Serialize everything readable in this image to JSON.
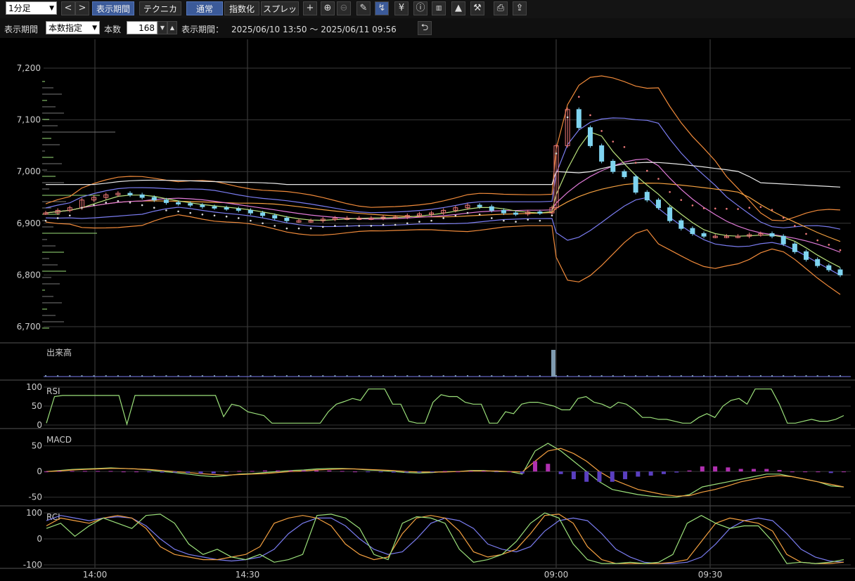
{
  "toolbar": {
    "timeframe": "1分足",
    "btn_period": "表示期間",
    "btn_technical": "テクニカル",
    "btn_normal": "通常",
    "btn_index": "指数化",
    "btn_spread": "スプレッド",
    "icons": [
      "crosshair-icon",
      "zoom-in-icon",
      "zoom-out-icon",
      "pencil-icon",
      "trend-tool-icon",
      "yen-icon",
      "info-icon",
      "my-chart-icon",
      "area-chart-icon",
      "wrench-icon",
      "print-icon",
      "export-icon"
    ]
  },
  "period_bar": {
    "label": "表示期間",
    "mode": "本数指定",
    "count_label": "本数",
    "count": "168",
    "range_label": "表示期間：",
    "range": "2025/06/10 13:50 ～ 2025/06/11 09:56"
  },
  "colors": {
    "ma_short": "#b8e07a",
    "ma_mid": "#e07ad8",
    "ma_long": "#f4a040",
    "bb_inner": "#7a7cf0",
    "bb_outer": "#f08a3a",
    "upper_band": "#e8e8e8",
    "sar_down": "#f07a7a",
    "sar_up": "#dddddd",
    "candle_up": "#f07a7a",
    "candle_down": "#7fd4f0",
    "rsi": "#9be07a",
    "macd": "#9be07a",
    "signal": "#f4a040",
    "hist_pos": "#b030b0",
    "hist_neg": "#5a3fc0",
    "rci_short": "#9be07a",
    "rci_mid": "#f4a040",
    "rci_long": "#7a7cf0"
  },
  "chart_data": {
    "type": "line",
    "price_axis": {
      "ticks": [
        "7,200",
        "7,100",
        "7,000",
        "6,900",
        "6,800",
        "6,700"
      ],
      "ylim": [
        6680,
        7225
      ]
    },
    "x_ticks": [
      "14:00",
      "14:30",
      "09:00",
      "09:30"
    ],
    "close": [
      6920,
      6925,
      6930,
      6945,
      6950,
      6955,
      6958,
      6955,
      6950,
      6945,
      6940,
      6938,
      6935,
      6932,
      6930,
      6928,
      6925,
      6920,
      6915,
      6910,
      6905,
      6905,
      6905,
      6908,
      6910,
      6910,
      6910,
      6910,
      6912,
      6912,
      6915,
      6918,
      6920,
      6925,
      6930,
      6935,
      6932,
      6925,
      6920,
      6918,
      6922,
      6920,
      6930,
      7050,
      7120,
      7085,
      7050,
      7020,
      7000,
      6990,
      6960,
      6945,
      6930,
      6905,
      6890,
      6880,
      6875,
      6875,
      6875,
      6875,
      6878,
      6880,
      6875,
      6860,
      6845,
      6830,
      6818,
      6810,
      6800
    ],
    "volume_panel": {
      "title": "出来高",
      "spike": "09:00"
    },
    "rsi_panel": {
      "title": "RSI",
      "ticks": [
        "100",
        "50",
        "0"
      ],
      "values": [
        5,
        75,
        78,
        78,
        78,
        78,
        78,
        78,
        78,
        78,
        2,
        78,
        78,
        78,
        78,
        78,
        78,
        78,
        78,
        78,
        78,
        78,
        22,
        55,
        50,
        35,
        30,
        25,
        5,
        5,
        5,
        5,
        5,
        5,
        5,
        35,
        55,
        62,
        70,
        65,
        95,
        95,
        95,
        55,
        55,
        10,
        5,
        5,
        60,
        80,
        75,
        75,
        60,
        55,
        55,
        5,
        5,
        35,
        30,
        55,
        60,
        60,
        55,
        50,
        40,
        40,
        70,
        75,
        60,
        55,
        45,
        60,
        55,
        40,
        20,
        20,
        15,
        15,
        10,
        5,
        5,
        20,
        30,
        20,
        50,
        65,
        70,
        55,
        95,
        95,
        95,
        55,
        5,
        5,
        10,
        15,
        10,
        10,
        15,
        25
      ]
    },
    "macd_panel": {
      "title": "MACD",
      "ticks": [
        "50",
        "0",
        "-50"
      ],
      "macd": [
        0,
        2,
        4,
        5,
        6,
        7,
        6,
        5,
        3,
        0,
        -2,
        -5,
        -8,
        -10,
        -8,
        -5,
        -4,
        -2,
        0,
        2,
        3,
        5,
        6,
        6,
        5,
        3,
        2,
        0,
        -2,
        -3,
        -2,
        0,
        0,
        2,
        2,
        0,
        0,
        -5,
        40,
        55,
        40,
        20,
        0,
        -20,
        -35,
        -40,
        -45,
        -48,
        -50,
        -50,
        -45,
        -30,
        -25,
        -20,
        -15,
        -10,
        -5,
        -5,
        -10,
        -15,
        -20,
        -28,
        -30
      ],
      "signal": [
        0,
        1,
        3,
        4,
        5,
        6,
        6,
        5,
        4,
        2,
        0,
        -2,
        -4,
        -6,
        -7,
        -6,
        -5,
        -4,
        -2,
        0,
        1,
        3,
        4,
        5,
        5,
        4,
        3,
        2,
        0,
        -1,
        -1,
        -1,
        0,
        1,
        1,
        1,
        0,
        -1,
        20,
        40,
        45,
        35,
        20,
        0,
        -15,
        -25,
        -35,
        -40,
        -45,
        -48,
        -47,
        -40,
        -35,
        -28,
        -20,
        -15,
        -10,
        -8,
        -10,
        -15,
        -20,
        -25,
        -30
      ],
      "hist": [
        0,
        1,
        1,
        1,
        1,
        1,
        0,
        0,
        -1,
        -2,
        -2,
        -3,
        -4,
        -4,
        -1,
        1,
        1,
        2,
        2,
        2,
        2,
        2,
        2,
        1,
        0,
        -1,
        -1,
        -2,
        -2,
        -2,
        -1,
        1,
        0,
        1,
        1,
        -1,
        0,
        -4,
        20,
        15,
        -5,
        -15,
        -20,
        -20,
        -20,
        -15,
        -10,
        -8,
        -5,
        -2,
        2,
        10,
        10,
        8,
        5,
        5,
        5,
        3,
        0,
        0,
        0,
        -3,
        0
      ]
    },
    "rci_panel": {
      "title": "RCI",
      "ticks": [
        "100",
        "0",
        "-100"
      ],
      "short": [
        40,
        60,
        10,
        50,
        80,
        60,
        40,
        90,
        95,
        60,
        -20,
        -60,
        -40,
        -70,
        -80,
        -60,
        -90,
        -80,
        -60,
        90,
        95,
        80,
        40,
        -60,
        -80,
        60,
        85,
        80,
        60,
        -40,
        -90,
        -80,
        -60,
        -10,
        60,
        100,
        80,
        -20,
        -80,
        -95,
        -95,
        -90,
        -95,
        -90,
        -60,
        60,
        90,
        60,
        40,
        50,
        50,
        -10,
        -95,
        -90,
        -95,
        -90,
        -80
      ],
      "mid": [
        50,
        80,
        70,
        60,
        80,
        90,
        80,
        40,
        -30,
        -60,
        -70,
        -80,
        -80,
        -70,
        -60,
        -30,
        60,
        80,
        90,
        80,
        50,
        -20,
        -60,
        -80,
        -70,
        20,
        80,
        90,
        80,
        30,
        -50,
        -70,
        -60,
        -40,
        20,
        90,
        95,
        60,
        -30,
        -80,
        -95,
        -95,
        -95,
        -95,
        -90,
        -80,
        -10,
        60,
        80,
        70,
        60,
        30,
        -60,
        -90,
        -95,
        -95,
        -90
      ],
      "long": [
        70,
        90,
        80,
        70,
        80,
        85,
        80,
        50,
        0,
        -40,
        -60,
        -70,
        -80,
        -85,
        -80,
        -70,
        -40,
        20,
        60,
        80,
        80,
        50,
        0,
        -40,
        -60,
        -50,
        0,
        60,
        80,
        70,
        40,
        -20,
        -40,
        -50,
        -30,
        30,
        70,
        80,
        70,
        20,
        -40,
        -70,
        -90,
        -95,
        -95,
        -90,
        -70,
        -20,
        40,
        70,
        80,
        70,
        20,
        -40,
        -70,
        -85,
        -90
      ]
    }
  }
}
